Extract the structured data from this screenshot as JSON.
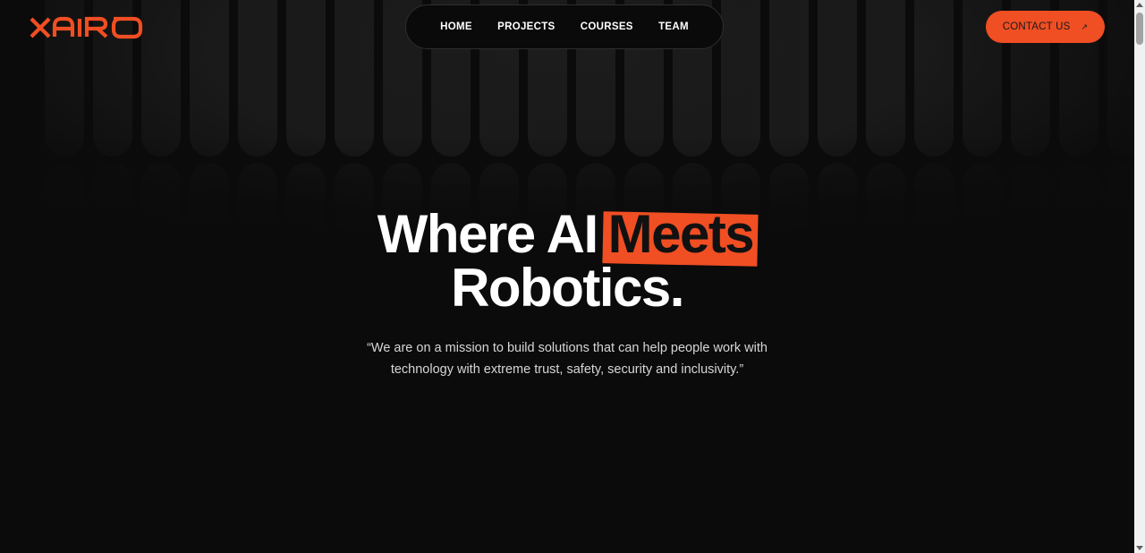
{
  "brand": {
    "name": "XAIRO",
    "color": "#f04e23"
  },
  "nav": {
    "items": [
      {
        "label": "HOME"
      },
      {
        "label": "PROJECTS"
      },
      {
        "label": "COURSES"
      },
      {
        "label": "TEAM"
      }
    ]
  },
  "contact": {
    "label": "CONTACT US",
    "icon": "arrow-up-right-icon",
    "arrow": "↗"
  },
  "hero": {
    "line1_prefix": "Where AI",
    "line1_highlight": "Meets",
    "line2": "Robotics.",
    "subtitle_line1": "“We are on a mission to build solutions that can help people work with",
    "subtitle_line2": "technology with extreme trust, safety, security and inclusivity.”"
  },
  "colors": {
    "accent": "#f04e23",
    "background": "#0b0b0b",
    "text": "#ffffff"
  }
}
